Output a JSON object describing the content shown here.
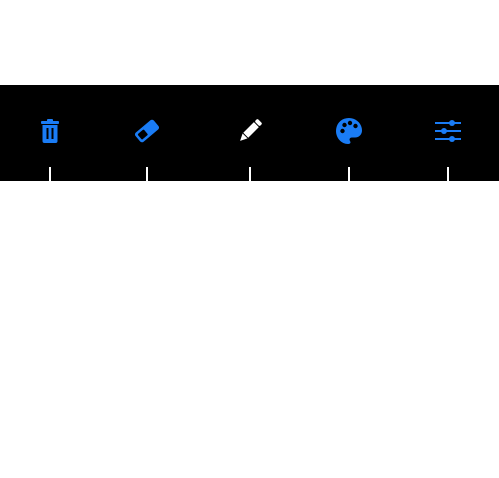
{
  "toolbar": {
    "tools": [
      {
        "id": "delete",
        "icon": "trash-icon",
        "selected": false
      },
      {
        "id": "eraser",
        "icon": "eraser-icon",
        "selected": false
      },
      {
        "id": "pencil",
        "icon": "pencil-icon",
        "selected": true
      },
      {
        "id": "palette",
        "icon": "palette-icon",
        "selected": false
      },
      {
        "id": "settings",
        "icon": "sliders-icon",
        "selected": false
      }
    ],
    "colors": {
      "background": "#000000",
      "accent": "#1a7cf5",
      "selected": "#ffffff",
      "tick": "#ffffff"
    }
  }
}
